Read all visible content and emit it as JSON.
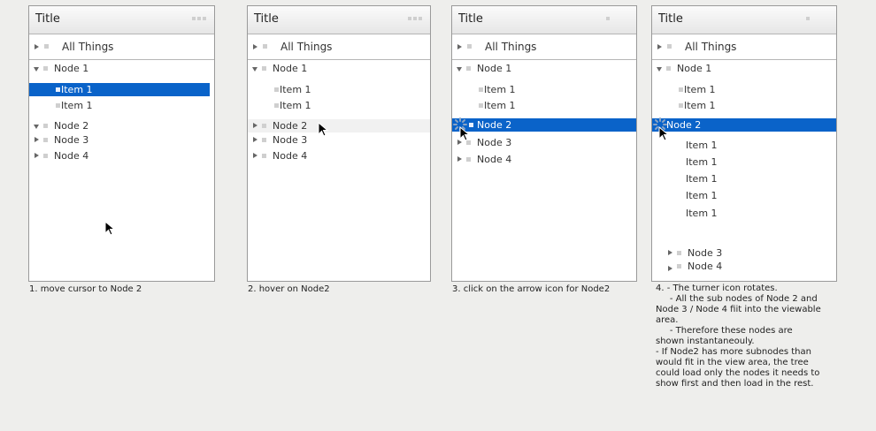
{
  "panels": [
    {
      "title": "Title",
      "all_things": "All Things",
      "rows": [
        {
          "label": "Node 1",
          "arrow": "down"
        },
        {
          "label": "Item 1",
          "selected": true
        },
        {
          "label": "Item 1"
        },
        {
          "label": "Node 2",
          "arrow": "down"
        },
        {
          "label": "Node 3",
          "arrow": "right"
        },
        {
          "label": "Node 4",
          "arrow": "right"
        }
      ],
      "caption": "1. move cursor to Node 2"
    },
    {
      "title": "Title",
      "all_things": "All Things",
      "rows": [
        {
          "label": "Node 1",
          "arrow": "down"
        },
        {
          "label": "Item 1"
        },
        {
          "label": "Item 1"
        },
        {
          "label": "Node 2",
          "arrow": "right",
          "hover": true
        },
        {
          "label": "Node 3",
          "arrow": "right"
        },
        {
          "label": "Node 4",
          "arrow": "right"
        }
      ],
      "caption": "2. hover on Node2"
    },
    {
      "title": "Title",
      "all_things": "All Things",
      "rows": [
        {
          "label": "Node 1",
          "arrow": "down"
        },
        {
          "label": "Item 1"
        },
        {
          "label": "Item 1"
        },
        {
          "label": "Node 2",
          "selected": true,
          "spinner": true
        },
        {
          "label": "Node 3",
          "arrow": "right"
        },
        {
          "label": "Node 4",
          "arrow": "right"
        }
      ],
      "caption": "3. click on the arrow icon for Node2"
    },
    {
      "title": "Title",
      "all_things": "All Things",
      "rows": [
        {
          "label": "Node 1",
          "arrow": "down"
        },
        {
          "label": "Item 1"
        },
        {
          "label": "Item 1"
        },
        {
          "label": "Node 2",
          "selected": true,
          "spinner": true
        },
        {
          "label": "Item 1"
        },
        {
          "label": "Item 1"
        },
        {
          "label": "Item 1"
        },
        {
          "label": "Item 1"
        },
        {
          "label": "Item 1"
        },
        {
          "label": "Node 3",
          "arrow": "right"
        },
        {
          "label": "Node 4",
          "arrow": "right"
        }
      ],
      "caption_lines": [
        "4. - The turner icon rotates.",
        "     - All the sub nodes of Node 2 and",
        "Node 3 / Node 4 fiit into the viewable",
        "area.",
        "     - Therefore these nodes are",
        "shown instantaneouly.",
        "- If Node2 has more subnodes than",
        "would fit in the view area, the tree",
        "could load only the nodes it needs to",
        "show first and then load in the rest."
      ]
    }
  ]
}
